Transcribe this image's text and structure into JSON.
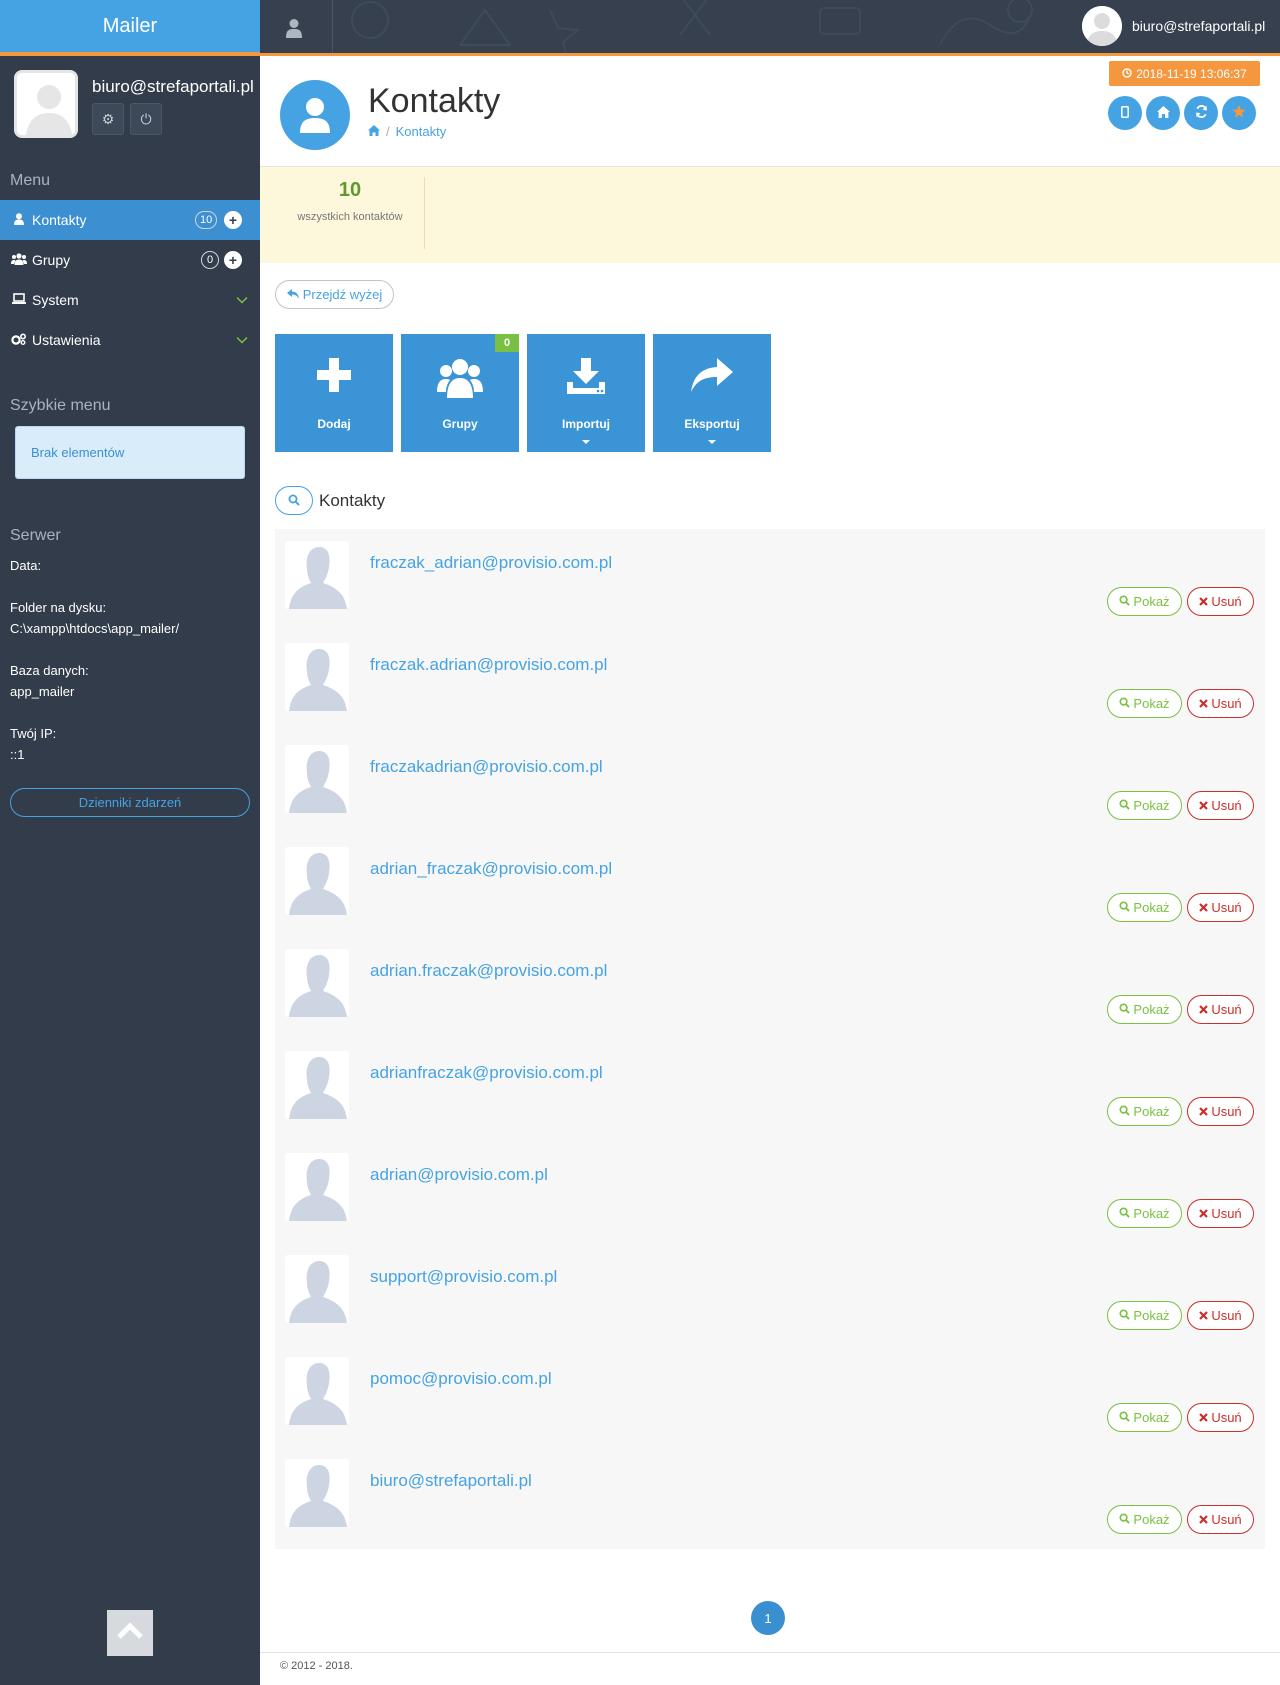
{
  "app": {
    "brand": "Mailer"
  },
  "user": {
    "email": "biuro@strefaportali.pl"
  },
  "sidebar": {
    "menu_heading": "Menu",
    "items": [
      {
        "label": "Kontakty",
        "icon": "user-icon",
        "count": "10",
        "active": true
      },
      {
        "label": "Grupy",
        "icon": "users-icon",
        "count": "0"
      },
      {
        "label": "System",
        "icon": "laptop-icon"
      },
      {
        "label": "Ustawienia",
        "icon": "cogs-icon"
      }
    ],
    "quick_heading": "Szybkie menu",
    "quick_empty": "Brak elementów",
    "server_heading": "Serwer",
    "server": {
      "date_label": "Data:",
      "folder_label": "Folder na dysku:",
      "folder_value": "C:\\xampp\\htdocs\\app_mailer/",
      "db_label": "Baza danych:",
      "db_value": "app_mailer",
      "ip_label": "Twój IP:",
      "ip_value": "::1"
    },
    "logs_button": "Dzienniki zdarzeń"
  },
  "header": {
    "title": "Kontakty",
    "breadcrumb": [
      "Kontakty"
    ],
    "timestamp": "2018-11-19 13:06:37",
    "icon_buttons": [
      "mobile-icon",
      "home-icon",
      "refresh-icon",
      "star-icon"
    ]
  },
  "stats": {
    "count": "10",
    "label": "wszystkich kontaktów"
  },
  "up_button": "Przejdź wyżej",
  "tiles": [
    {
      "label": "Dodaj",
      "icon": "plus-icon"
    },
    {
      "label": "Grupy",
      "icon": "users-icon",
      "badge": "0"
    },
    {
      "label": "Importuj",
      "icon": "download-icon"
    },
    {
      "label": "Eksportuj",
      "icon": "share-icon"
    }
  ],
  "list": {
    "title": "Kontakty",
    "show_label": "Pokaż",
    "delete_label": "Usuń",
    "contacts": [
      "fraczak_adrian@provisio.com.pl",
      "fraczak.adrian@provisio.com.pl",
      "fraczakadrian@provisio.com.pl",
      "adrian_fraczak@provisio.com.pl",
      "adrian.fraczak@provisio.com.pl",
      "adrianfraczak@provisio.com.pl",
      "adrian@provisio.com.pl",
      "support@provisio.com.pl",
      "pomoc@provisio.com.pl",
      "biuro@strefaportali.pl"
    ]
  },
  "pagination": {
    "current": "1"
  },
  "footer": {
    "text": "© 2012 - 2018."
  },
  "colors": {
    "primary": "#45a3e3",
    "accent": "#f4973f",
    "sidebar": "#323c4a",
    "success": "#7ac143",
    "danger": "#c9302c",
    "stats_bg": "#fdf8dc"
  }
}
